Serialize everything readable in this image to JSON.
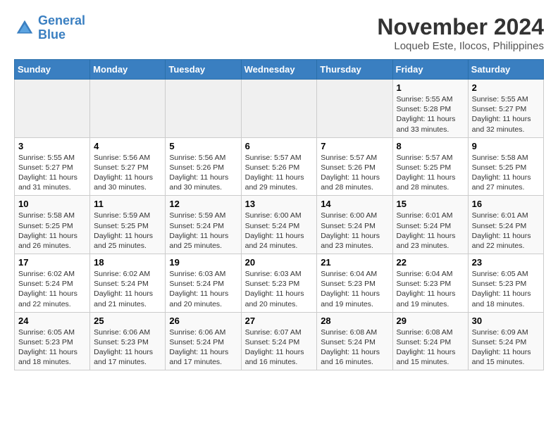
{
  "header": {
    "logo_line1": "General",
    "logo_line2": "Blue",
    "month_year": "November 2024",
    "location": "Loqueb Este, Ilocos, Philippines"
  },
  "days_of_week": [
    "Sunday",
    "Monday",
    "Tuesday",
    "Wednesday",
    "Thursday",
    "Friday",
    "Saturday"
  ],
  "weeks": [
    [
      {
        "day": "",
        "empty": true
      },
      {
        "day": "",
        "empty": true
      },
      {
        "day": "",
        "empty": true
      },
      {
        "day": "",
        "empty": true
      },
      {
        "day": "",
        "empty": true
      },
      {
        "day": "1",
        "sunrise": "5:55 AM",
        "sunset": "5:28 PM",
        "daylight": "11 hours and 33 minutes."
      },
      {
        "day": "2",
        "sunrise": "5:55 AM",
        "sunset": "5:27 PM",
        "daylight": "11 hours and 32 minutes."
      }
    ],
    [
      {
        "day": "3",
        "sunrise": "5:55 AM",
        "sunset": "5:27 PM",
        "daylight": "11 hours and 31 minutes."
      },
      {
        "day": "4",
        "sunrise": "5:56 AM",
        "sunset": "5:27 PM",
        "daylight": "11 hours and 30 minutes."
      },
      {
        "day": "5",
        "sunrise": "5:56 AM",
        "sunset": "5:26 PM",
        "daylight": "11 hours and 30 minutes."
      },
      {
        "day": "6",
        "sunrise": "5:57 AM",
        "sunset": "5:26 PM",
        "daylight": "11 hours and 29 minutes."
      },
      {
        "day": "7",
        "sunrise": "5:57 AM",
        "sunset": "5:26 PM",
        "daylight": "11 hours and 28 minutes."
      },
      {
        "day": "8",
        "sunrise": "5:57 AM",
        "sunset": "5:25 PM",
        "daylight": "11 hours and 28 minutes."
      },
      {
        "day": "9",
        "sunrise": "5:58 AM",
        "sunset": "5:25 PM",
        "daylight": "11 hours and 27 minutes."
      }
    ],
    [
      {
        "day": "10",
        "sunrise": "5:58 AM",
        "sunset": "5:25 PM",
        "daylight": "11 hours and 26 minutes."
      },
      {
        "day": "11",
        "sunrise": "5:59 AM",
        "sunset": "5:25 PM",
        "daylight": "11 hours and 25 minutes."
      },
      {
        "day": "12",
        "sunrise": "5:59 AM",
        "sunset": "5:24 PM",
        "daylight": "11 hours and 25 minutes."
      },
      {
        "day": "13",
        "sunrise": "6:00 AM",
        "sunset": "5:24 PM",
        "daylight": "11 hours and 24 minutes."
      },
      {
        "day": "14",
        "sunrise": "6:00 AM",
        "sunset": "5:24 PM",
        "daylight": "11 hours and 23 minutes."
      },
      {
        "day": "15",
        "sunrise": "6:01 AM",
        "sunset": "5:24 PM",
        "daylight": "11 hours and 23 minutes."
      },
      {
        "day": "16",
        "sunrise": "6:01 AM",
        "sunset": "5:24 PM",
        "daylight": "11 hours and 22 minutes."
      }
    ],
    [
      {
        "day": "17",
        "sunrise": "6:02 AM",
        "sunset": "5:24 PM",
        "daylight": "11 hours and 22 minutes."
      },
      {
        "day": "18",
        "sunrise": "6:02 AM",
        "sunset": "5:24 PM",
        "daylight": "11 hours and 21 minutes."
      },
      {
        "day": "19",
        "sunrise": "6:03 AM",
        "sunset": "5:24 PM",
        "daylight": "11 hours and 20 minutes."
      },
      {
        "day": "20",
        "sunrise": "6:03 AM",
        "sunset": "5:23 PM",
        "daylight": "11 hours and 20 minutes."
      },
      {
        "day": "21",
        "sunrise": "6:04 AM",
        "sunset": "5:23 PM",
        "daylight": "11 hours and 19 minutes."
      },
      {
        "day": "22",
        "sunrise": "6:04 AM",
        "sunset": "5:23 PM",
        "daylight": "11 hours and 19 minutes."
      },
      {
        "day": "23",
        "sunrise": "6:05 AM",
        "sunset": "5:23 PM",
        "daylight": "11 hours and 18 minutes."
      }
    ],
    [
      {
        "day": "24",
        "sunrise": "6:05 AM",
        "sunset": "5:23 PM",
        "daylight": "11 hours and 18 minutes."
      },
      {
        "day": "25",
        "sunrise": "6:06 AM",
        "sunset": "5:23 PM",
        "daylight": "11 hours and 17 minutes."
      },
      {
        "day": "26",
        "sunrise": "6:06 AM",
        "sunset": "5:24 PM",
        "daylight": "11 hours and 17 minutes."
      },
      {
        "day": "27",
        "sunrise": "6:07 AM",
        "sunset": "5:24 PM",
        "daylight": "11 hours and 16 minutes."
      },
      {
        "day": "28",
        "sunrise": "6:08 AM",
        "sunset": "5:24 PM",
        "daylight": "11 hours and 16 minutes."
      },
      {
        "day": "29",
        "sunrise": "6:08 AM",
        "sunset": "5:24 PM",
        "daylight": "11 hours and 15 minutes."
      },
      {
        "day": "30",
        "sunrise": "6:09 AM",
        "sunset": "5:24 PM",
        "daylight": "11 hours and 15 minutes."
      }
    ]
  ]
}
